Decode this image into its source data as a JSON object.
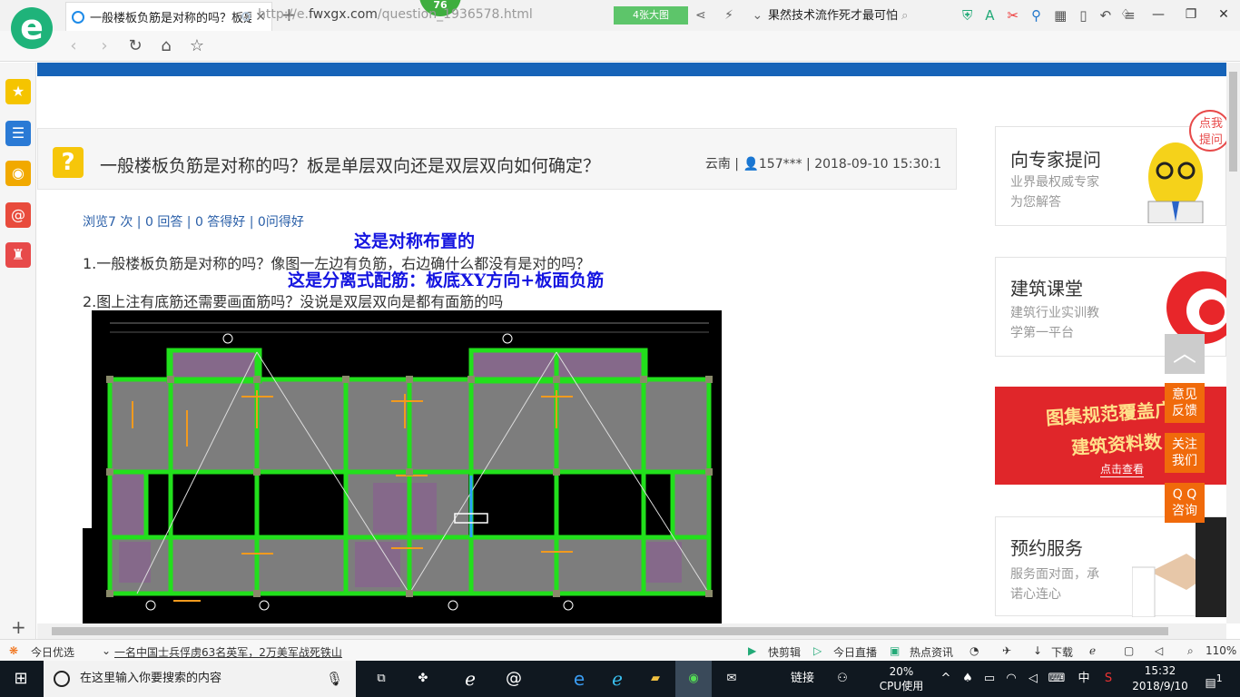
{
  "browser": {
    "badge": "76",
    "tab_title": "一般楼板负筋是对称的吗？板是单",
    "url_domain": "fwxgx.com",
    "url_prefix": "http://e.",
    "url_suffix": "/question_1936578.html",
    "big_image_button": "4张大图",
    "search_text": "果然技术流作死才最可怕"
  },
  "question": {
    "title": "一般楼板负筋是对称的吗？板是单层双向还是双层双向如何确定？",
    "meta": "云南 | 👤157*** | 2018-09-10 15:30:1",
    "stats": "浏览7 次 | 0 回答 | 0 答得好 | 0问得好",
    "annotation_1": "这是对称布置的",
    "line_1": "1.一般楼板负筋是对称的吗？像图一左边有负筋，右边确什么都没有是对的吗？",
    "annotation_2": "这是分离式配筋：板底XY方向+板面负筋",
    "line_2": "2.图上注有底筋还需要画面筋吗？没说是双层双向是都有面筋的吗"
  },
  "sidebar_cards": [
    {
      "title": "向专家提问",
      "desc1": "业界最权威专家",
      "desc2": "为您解答"
    },
    {
      "title": "建筑课堂",
      "desc1": "建筑行业实训教",
      "desc2": "学第一平台"
    },
    {
      "title": "预约服务",
      "desc1": "服务面对面，承",
      "desc2": "诺心连心"
    }
  ],
  "banner": {
    "line1": "图集规范覆盖广",
    "line2": "建筑资料数",
    "button": "点击查看"
  },
  "bubble": {
    "line1": "点我",
    "line2": "提问"
  },
  "float_buttons": [
    {
      "l1": "意见",
      "l2": "反馈"
    },
    {
      "l1": "关注",
      "l2": "我们"
    },
    {
      "l1": "Q Q",
      "l2": "咨询"
    }
  ],
  "statusbar": {
    "today": "今日优选",
    "news": "一名中国士兵俘虏63名英军，2万美军战死铁山",
    "fast_clip": "快剪辑",
    "live": "今日直播",
    "hot": "热点资讯",
    "download": "下载",
    "zoom": "110%"
  },
  "taskbar": {
    "search_placeholder": "在这里输入你要搜索的内容",
    "link": "链接",
    "cpu_pct": "20%",
    "cpu_label": "CPU使用",
    "ime": "中",
    "time": "15:32",
    "date": "2018/9/10",
    "notifications": "1"
  },
  "colors": {
    "accent_blue": "#1663b8",
    "orange": "#f06a0b",
    "green": "#1fb37a"
  }
}
